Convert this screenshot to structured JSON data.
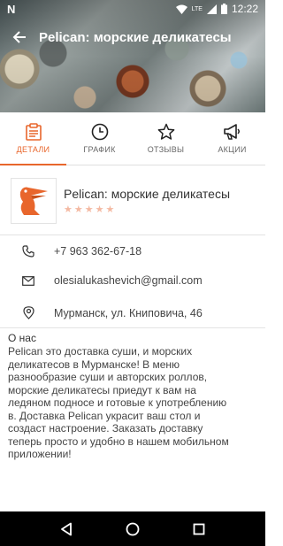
{
  "status_bar": {
    "left_icon": "n-notification-icon",
    "network": "LTE",
    "time": "12:22"
  },
  "header": {
    "title": "Pelican: морские деликатесы",
    "back_icon": "arrow-back-icon"
  },
  "tabs": [
    {
      "label": "ДЕТАЛИ",
      "icon": "clipboard-icon",
      "active": true
    },
    {
      "label": "ГРАФИК",
      "icon": "clock-icon",
      "active": false
    },
    {
      "label": "ОТЗЫВЫ",
      "icon": "star-icon",
      "active": false
    },
    {
      "label": "АКЦИИ",
      "icon": "megaphone-icon",
      "active": false
    }
  ],
  "business": {
    "name": "Pelican: морские деликатесы",
    "rating": 0,
    "rating_max": 5
  },
  "contacts": {
    "phone": "+7 963 362-67-18",
    "email": "olesialukashevich@gmail.com",
    "address": "Мурманск, ул. Книповича, 46"
  },
  "about": {
    "title": "О нас",
    "text": "Pelican это доставка суши, и морских\nделикатесов в Мурманске! В меню\nразнообразие суши и  авторских роллов,\nморские деликатесы приедут к вам на\nледяном подносе и готовые к употреблению\nв.  Доставка Pelican украсит ваш стол и\nсоздаст настроение. Заказать доставку\nтеперь просто и удобно в нашем мобильном\nприложении!"
  },
  "colors": {
    "accent": "#e8662c",
    "star_empty": "#f4b9a2"
  }
}
